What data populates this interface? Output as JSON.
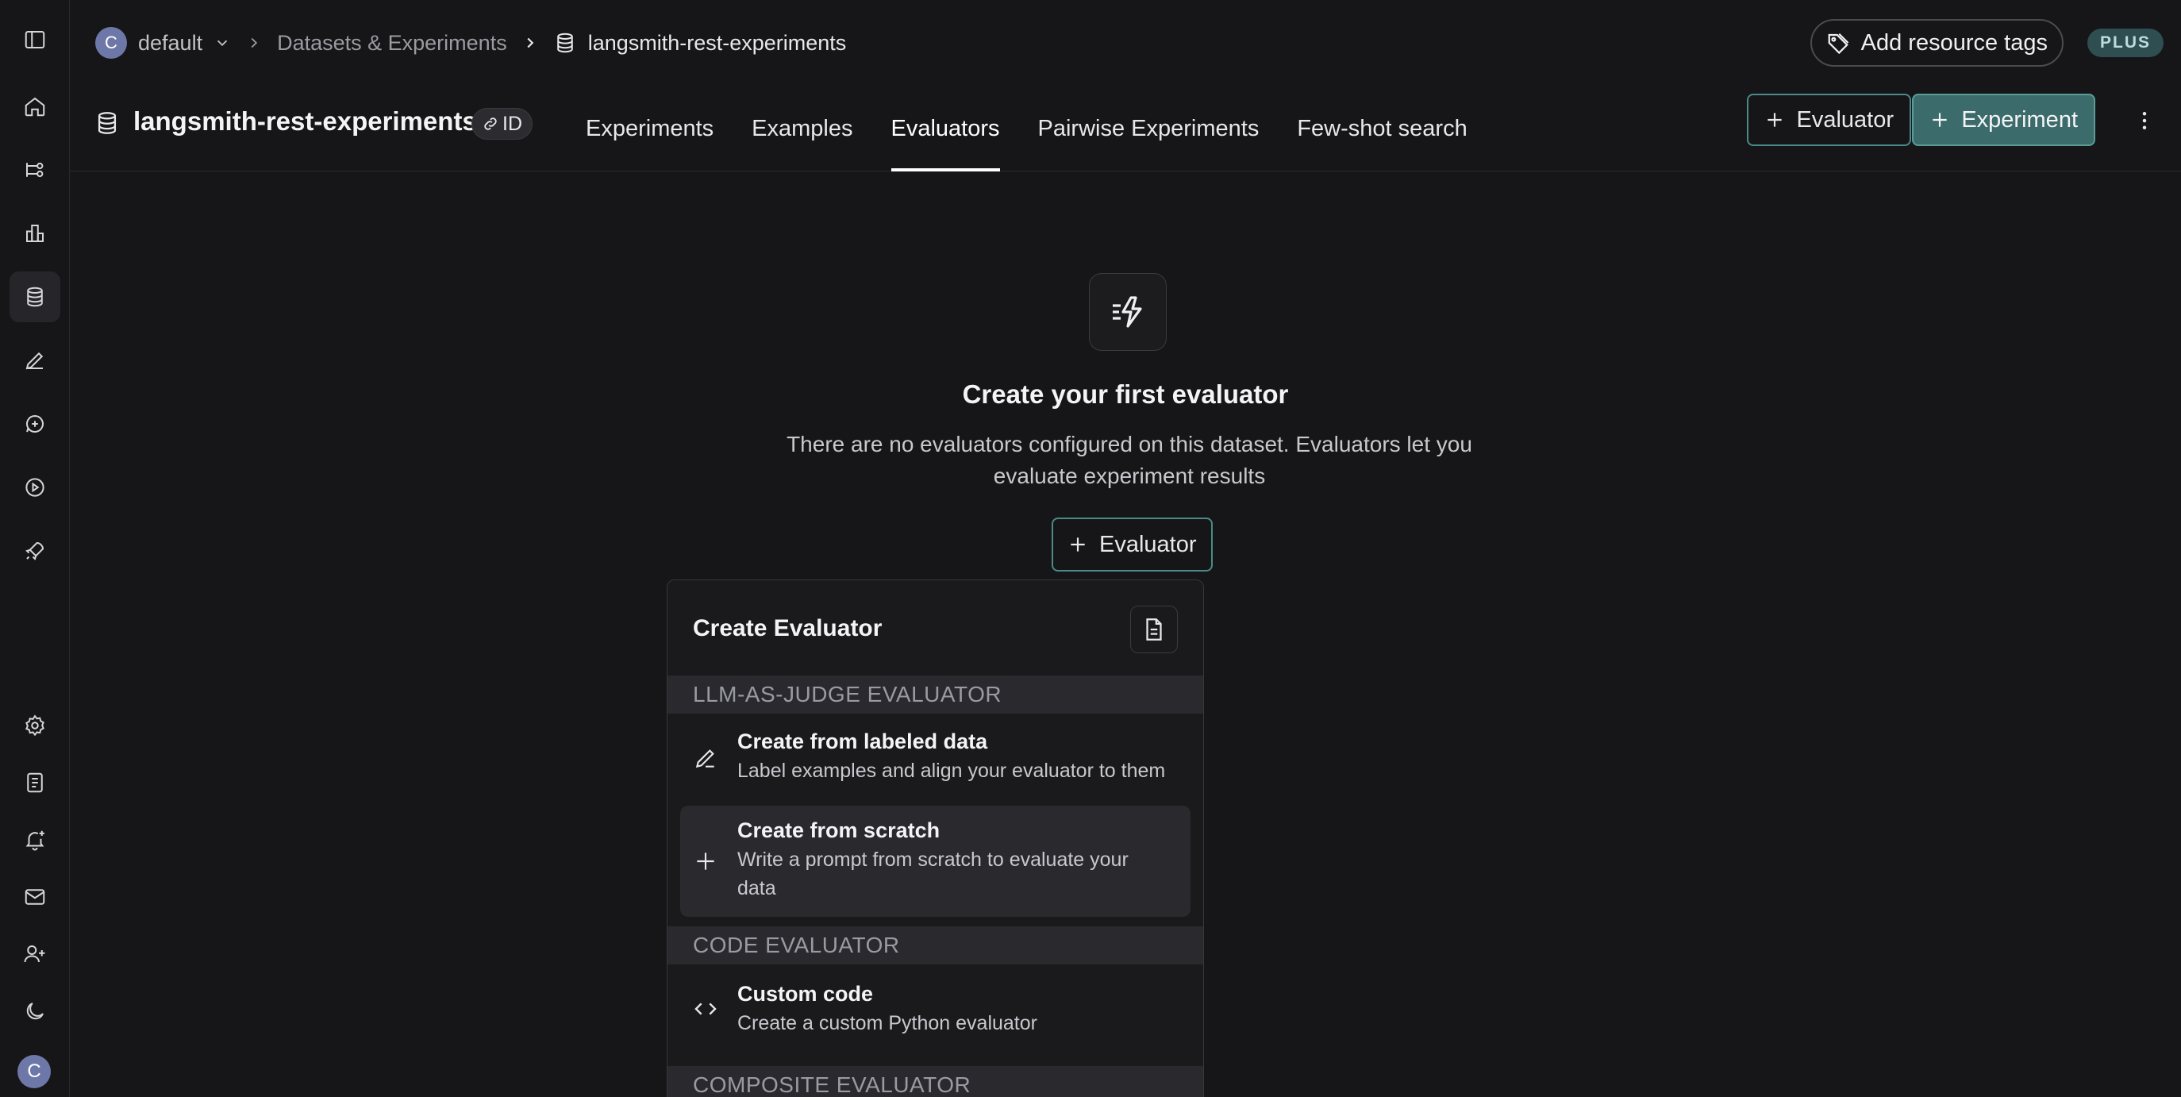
{
  "rail": {
    "items": [
      {
        "icon": "sidebar-toggle-icon"
      },
      {
        "icon": "home-icon"
      },
      {
        "icon": "projects-icon"
      },
      {
        "icon": "dashboards-icon"
      },
      {
        "icon": "datasets-icon",
        "active": true
      },
      {
        "icon": "annotation-queues-icon"
      },
      {
        "icon": "prompts-icon"
      },
      {
        "icon": "playground-icon"
      },
      {
        "icon": "deployments-icon"
      },
      {
        "icon": "settings-icon"
      },
      {
        "icon": "docs-icon"
      },
      {
        "icon": "alerts-icon"
      },
      {
        "icon": "mail-icon"
      },
      {
        "icon": "invite-user-icon"
      },
      {
        "icon": "theme-moon-icon"
      }
    ],
    "avatar_letter": "C"
  },
  "topbar": {
    "org_avatar_letter": "C",
    "org_name": "default",
    "breadcrumb_parent": "Datasets & Experiments",
    "breadcrumb_current": "langsmith-rest-experiments",
    "tags_button": "Add resource tags",
    "plan_badge": "PLUS"
  },
  "header": {
    "dataset_name": "langsmith-rest-experiments",
    "id_label": "ID",
    "tabs": [
      {
        "label": "Experiments",
        "active": false
      },
      {
        "label": "Examples",
        "active": false
      },
      {
        "label": "Evaluators",
        "active": true
      },
      {
        "label": "Pairwise Experiments",
        "active": false
      },
      {
        "label": "Few-shot search",
        "active": false
      }
    ],
    "evaluator_button": "Evaluator",
    "experiment_button": "Experiment"
  },
  "empty_state": {
    "title": "Create your first evaluator",
    "description": "There are no evaluators configured on this dataset. Evaluators let you evaluate experiment results",
    "button": "Evaluator"
  },
  "dropdown": {
    "title": "Create Evaluator",
    "sections": [
      {
        "header": "LLM-AS-JUDGE EVALUATOR",
        "items": [
          {
            "icon": "pencil-icon",
            "title": "Create from labeled data",
            "description": "Label examples and align your evaluator to them"
          },
          {
            "icon": "plus-icon",
            "title": "Create from scratch",
            "description": "Write a prompt from scratch to evaluate your data",
            "hovered": true
          }
        ]
      },
      {
        "header": "CODE EVALUATOR",
        "items": [
          {
            "icon": "code-icon",
            "title": "Custom code",
            "description": "Create a custom Python evaluator"
          }
        ]
      },
      {
        "header": "COMPOSITE EVALUATOR",
        "items": []
      }
    ]
  },
  "colors": {
    "background": "#161618",
    "accent_teal": "#3b6b6b",
    "accent_border": "#4a8a88",
    "plan_badge_bg": "#2f4e52"
  }
}
